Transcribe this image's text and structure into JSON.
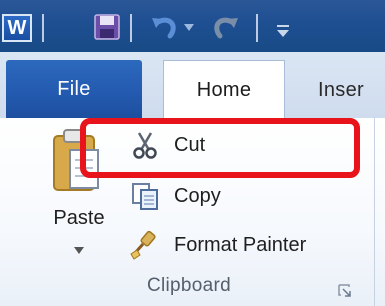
{
  "quick_access": {
    "app_icon_letter": "W",
    "icons": [
      "word-icon",
      "save-icon",
      "undo-icon",
      "redo-icon",
      "customize-icon"
    ]
  },
  "tabs": [
    {
      "label": "File"
    },
    {
      "label": "Home"
    },
    {
      "label": "Inser"
    }
  ],
  "clipboard": {
    "paste_label": "Paste",
    "commands": [
      {
        "label": "Cut",
        "icon": "scissors-icon"
      },
      {
        "label": "Copy",
        "icon": "copy-icon"
      },
      {
        "label": "Format Painter",
        "icon": "format-painter-icon"
      }
    ],
    "group_label": "Clipboard"
  },
  "colors": {
    "title_bar": "#1e4f92",
    "file_tab": "#245bb0",
    "highlight": "#e8131b"
  }
}
